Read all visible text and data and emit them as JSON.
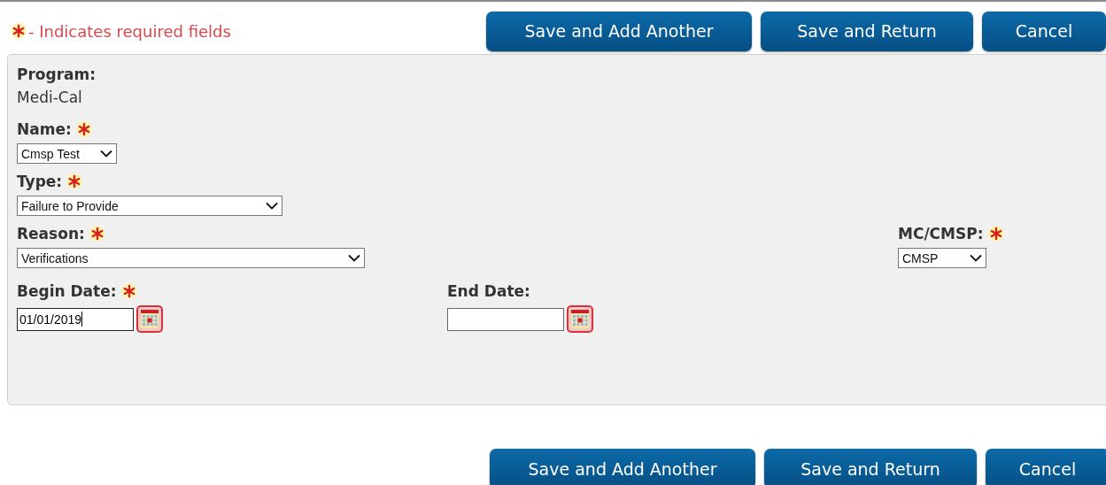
{
  "required_note": "- Indicates required fields",
  "top_buttons": [
    "Save and Add Another",
    "Save and Return",
    "Cancel"
  ],
  "rows": [
    {
      "fields": [
        {
          "kind": "text",
          "label": "Program:",
          "required": false,
          "value": "Medi-Cal"
        }
      ]
    },
    {
      "fields": [
        {
          "kind": "select",
          "label": "Name:",
          "required": true,
          "value": "Cmsp Test"
        }
      ]
    },
    {
      "fields": [
        {
          "kind": "select",
          "label": "Type:",
          "required": true,
          "value": "Failure to Provide"
        }
      ]
    },
    {
      "fields": [
        {
          "kind": "select",
          "label": "Reason:",
          "required": true,
          "value": "Verifications"
        },
        {
          "kind": "select",
          "label": "MC/CMSP:",
          "required": true,
          "value": "CMSP"
        }
      ]
    },
    {
      "fields": [
        {
          "kind": "date",
          "label": "Begin Date:",
          "required": true,
          "value": "01/01/2019",
          "focused": true
        },
        {
          "kind": "date",
          "label": "End Date:",
          "required": false,
          "focused": false
        }
      ]
    }
  ],
  "bottom_buttons": [
    "Save and Add Another",
    "Save and Return",
    "Cancel"
  ]
}
